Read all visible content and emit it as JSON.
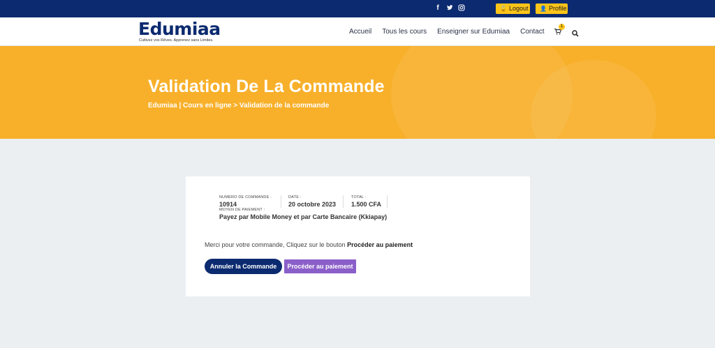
{
  "topbar": {
    "social": [
      {
        "icon": "facebook-icon",
        "glyph": "f"
      },
      {
        "icon": "twitter-icon",
        "glyph": "t"
      },
      {
        "icon": "instagram-icon",
        "glyph": "◎"
      }
    ],
    "logout_label": "Logout",
    "profile_label": "Profile",
    "bg_color": "#0b2a6f",
    "button_color": "#fcc419"
  },
  "header": {
    "logo_text": "Edumiaa",
    "logo_tagline": "Cultivez vos Rêves. Apprenez sans Limites.",
    "nav": [
      "Accueil",
      "Tous les cours",
      "Enseigner sur Edumiaa",
      "Contact"
    ],
    "cart_count": "1"
  },
  "hero": {
    "title": "Validation De La Commande",
    "breadcrumb": "Edumiaa | Cours en ligne > Validation de la commande",
    "bg_color": "#f8b02a"
  },
  "order": {
    "number_label": "Numéro de commande :",
    "number_value": "10914",
    "date_label": "Date :",
    "date_value": "20 octobre 2023",
    "total_label": "Total :",
    "total_value": "1.500 CFA",
    "payment_label": "Moyen de paiement :",
    "payment_value": "Payez par Mobile Money et par Carte Bancaire (Kkiapay)",
    "thanks_text": "Merci pour votre commande, Cliquez sur le bouton",
    "thanks_bold": "Procéder au paiement",
    "cancel_label": "Annuler la Commande",
    "pay_label": "Procéder au paiement",
    "cancel_color": "#0b2a6f",
    "pay_color": "#8b5fc9"
  }
}
